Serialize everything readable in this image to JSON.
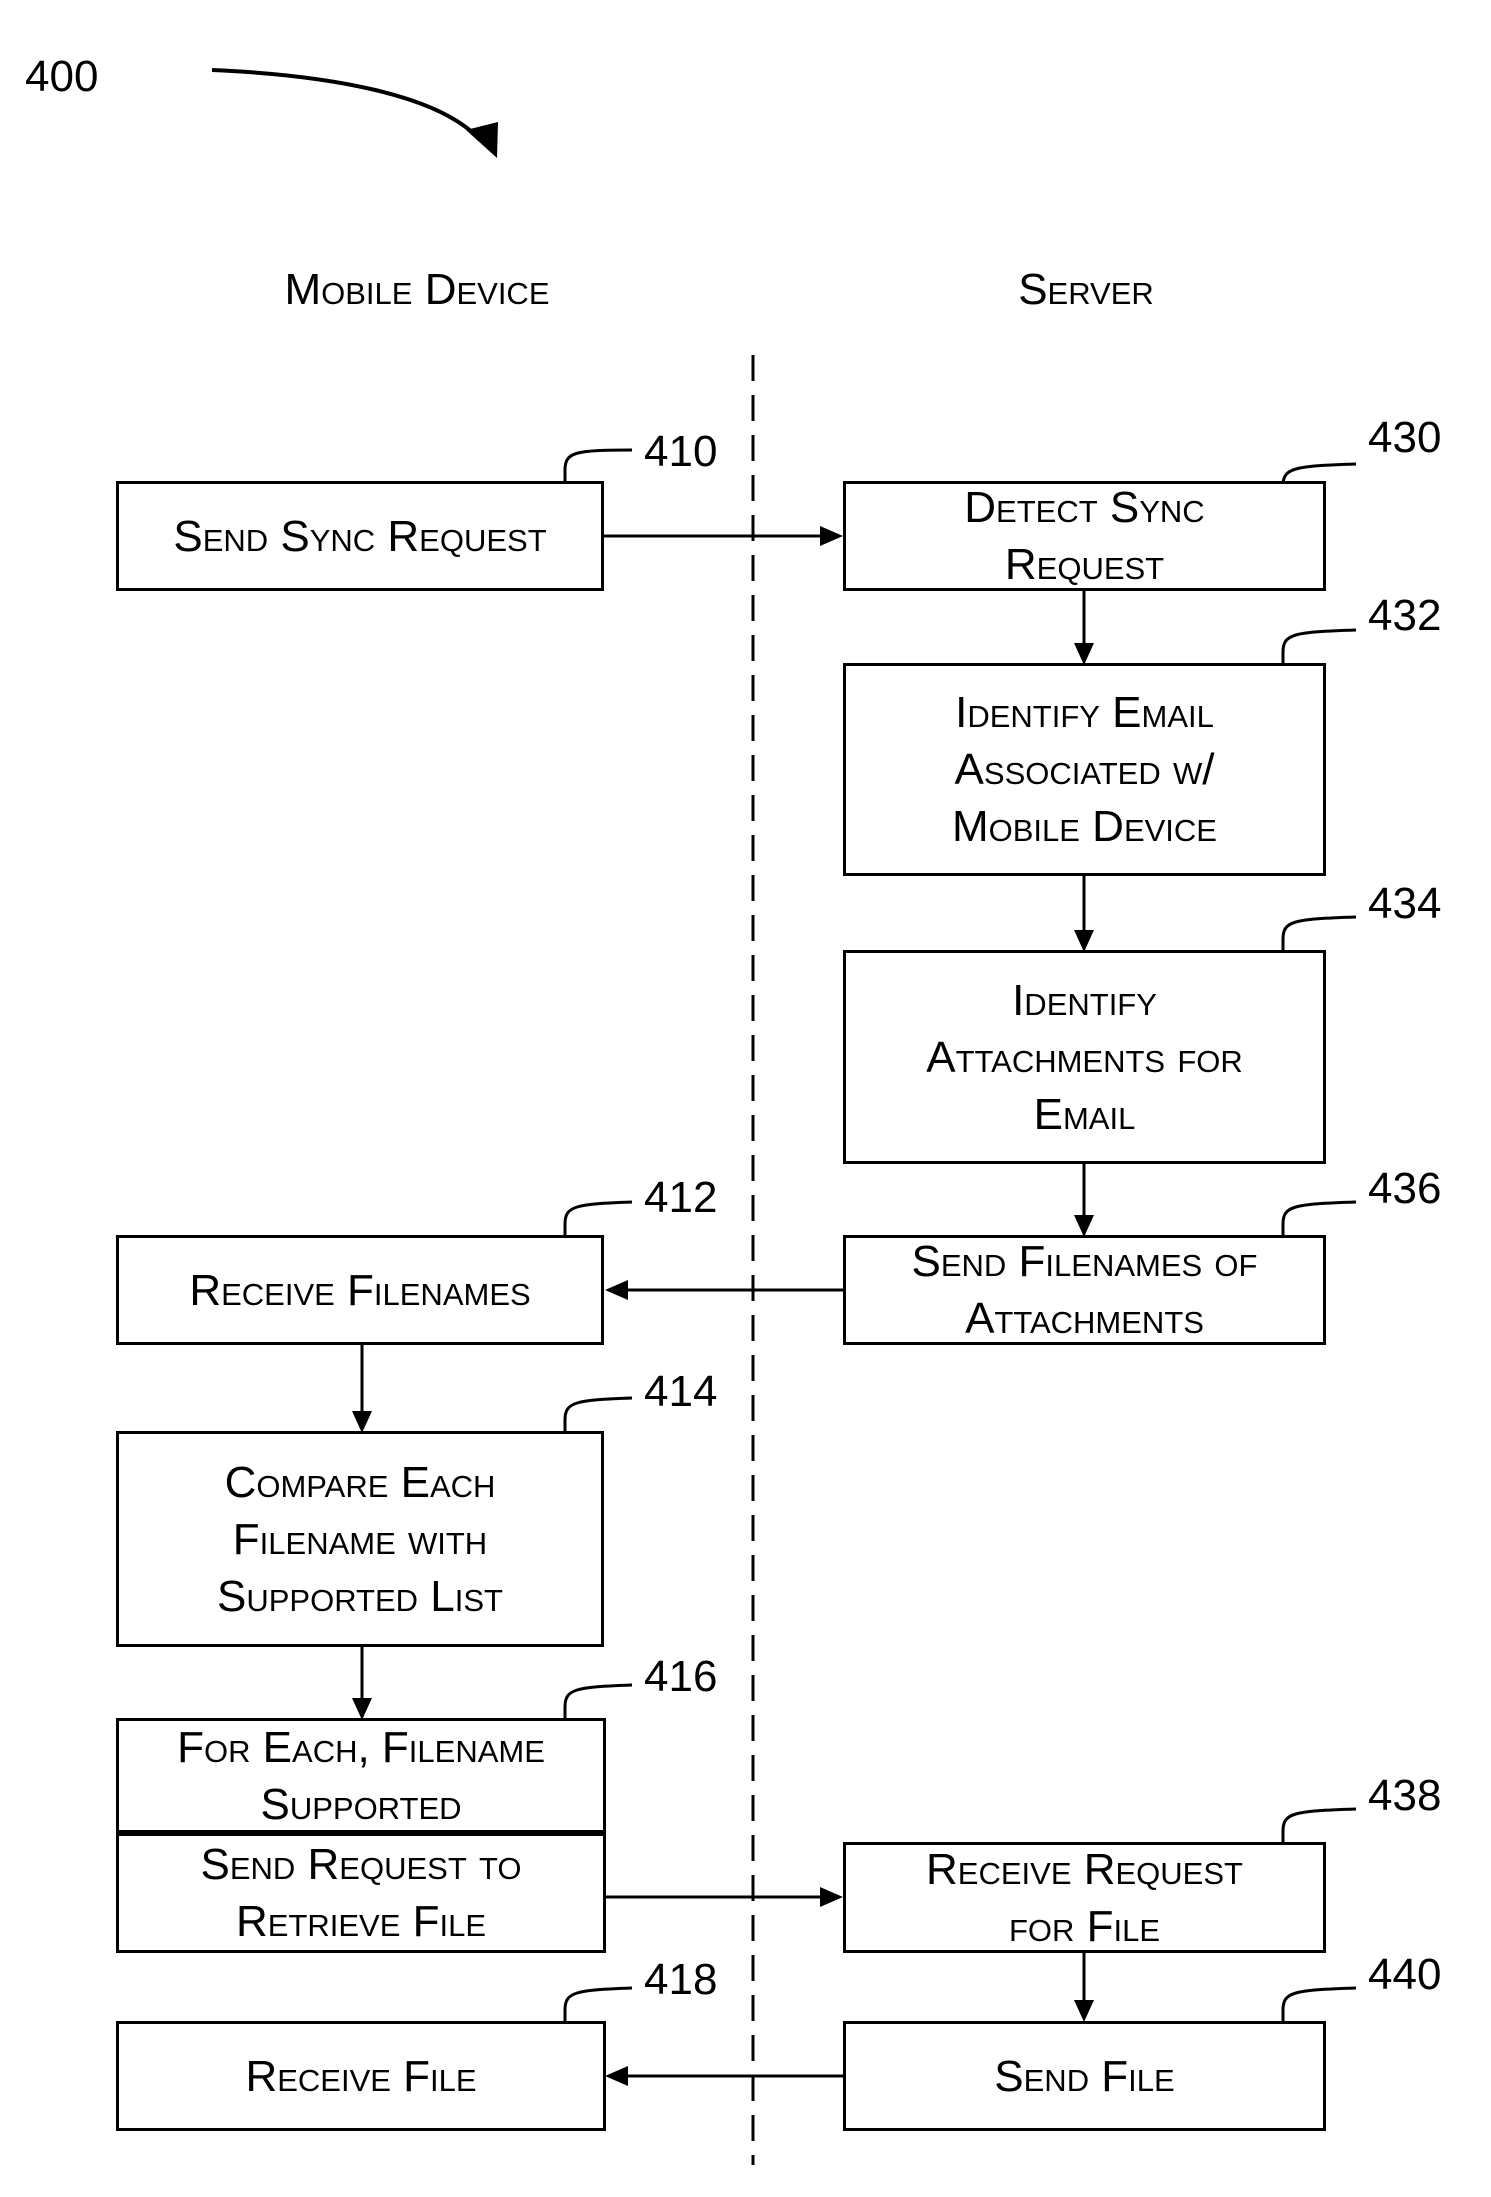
{
  "figure": {
    "number": "400"
  },
  "columns": {
    "left": "Mobile Device",
    "right": "Server"
  },
  "steps": {
    "s410": {
      "ref": "410",
      "lines": [
        "Send Sync Request"
      ]
    },
    "s412": {
      "ref": "412",
      "lines": [
        "Receive Filenames"
      ]
    },
    "s414": {
      "ref": "414",
      "lines": [
        "Compare Each",
        "Filename with",
        "Supported List"
      ]
    },
    "s416": {
      "ref": "416",
      "top_lines": [
        "For Each, Filename",
        "Supported"
      ],
      "bottom_lines": [
        "Send Request to",
        "Retrieve File"
      ]
    },
    "s418": {
      "ref": "418",
      "lines": [
        "Receive File"
      ]
    },
    "s430": {
      "ref": "430",
      "lines": [
        "Detect Sync",
        "Request"
      ]
    },
    "s432": {
      "ref": "432",
      "lines": [
        "Identify Email",
        "Associated w/",
        "Mobile Device"
      ]
    },
    "s434": {
      "ref": "434",
      "lines": [
        "Identify",
        "Attachments for",
        "Email"
      ]
    },
    "s436": {
      "ref": "436",
      "lines": [
        "Send Filenames of",
        "Attachments"
      ]
    },
    "s438": {
      "ref": "438",
      "lines": [
        "Receive Request",
        "for File"
      ]
    },
    "s440": {
      "ref": "440",
      "lines": [
        "Send File"
      ]
    }
  }
}
